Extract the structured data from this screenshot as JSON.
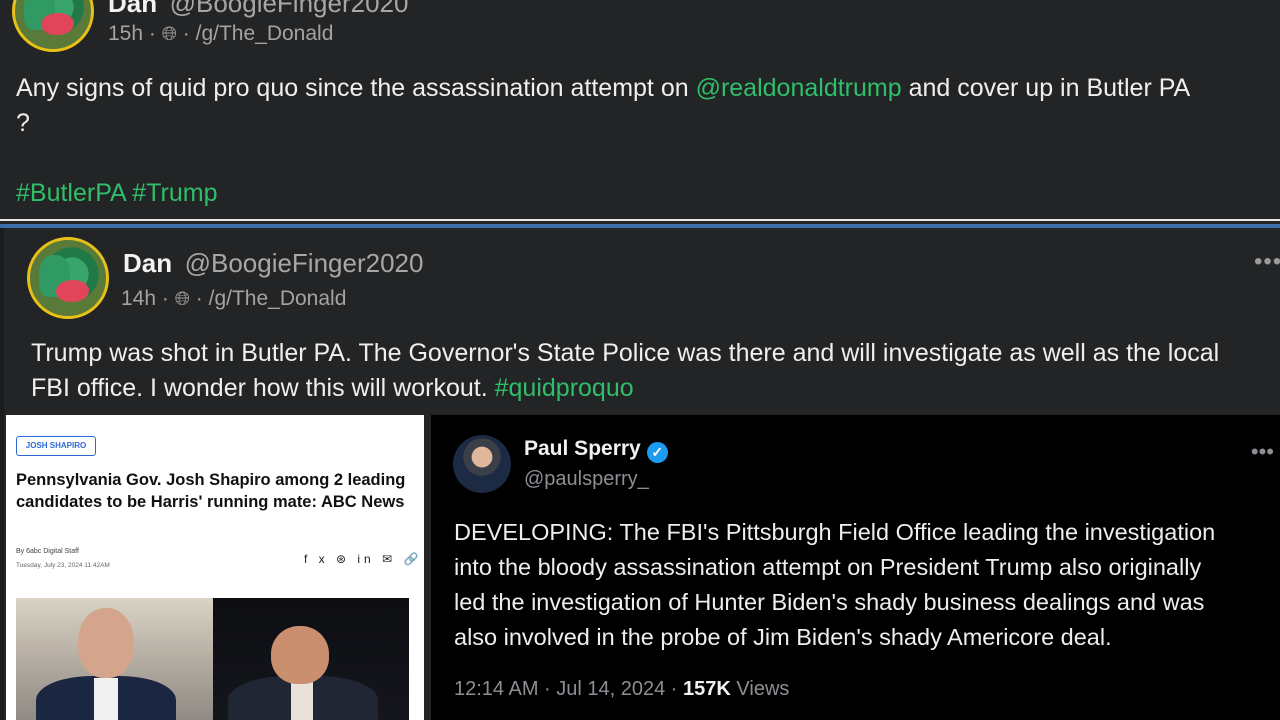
{
  "post1": {
    "name": "Dan",
    "handle": "@BoogieFinger2020",
    "time": "15h",
    "community": "/g/The_Donald",
    "text_before": "Any signs of quid pro quo since the assassination attempt on ",
    "mention": "@realdonaldtrump",
    "text_after": " and cover up in Butler PA",
    "text_line2": "?",
    "hashtags": [
      "#ButlerPA",
      "#Trump"
    ]
  },
  "post2": {
    "name": "Dan",
    "handle": "@BoogieFinger2020",
    "time": "14h",
    "community": "/g/The_Donald",
    "menu": "•••",
    "text_line1": "Trump was shot in Butler PA. The Governor's State Police was there and will investigate as well as the local",
    "text_line2": "FBI office. I wonder how this will workout. ",
    "hashtag": "#quidproquo"
  },
  "article": {
    "tag": "JOSH SHAPIRO",
    "headline": "Pennsylvania Gov. Josh Shapiro among 2 leading candidates to be Harris' running mate: ABC News",
    "byline": "By 6abc Digital Staff",
    "dateline": "Tuesday, July 23, 2024 11:42AM",
    "share_icons": "f x ⊛ in ✉ 🔗"
  },
  "tweet": {
    "name": "Paul Sperry",
    "verified_mark": "✓",
    "handle": "@paulsperry_",
    "menu": "•••",
    "lines": [
      "DEVELOPING: The FBI's Pittsburgh Field Office leading the investigation",
      "into the bloody assassination attempt on President Trump also originally",
      "led the investigation of Hunter Biden's shady business dealings and was",
      "also involved in the probe of Jim Biden's shady Americore deal."
    ],
    "timestamp": "12:14 AM · Jul 14, 2024 · ",
    "views_count": "157K",
    "views_label": " Views"
  },
  "separator": "·",
  "icons": {
    "globe": "globe-icon"
  }
}
